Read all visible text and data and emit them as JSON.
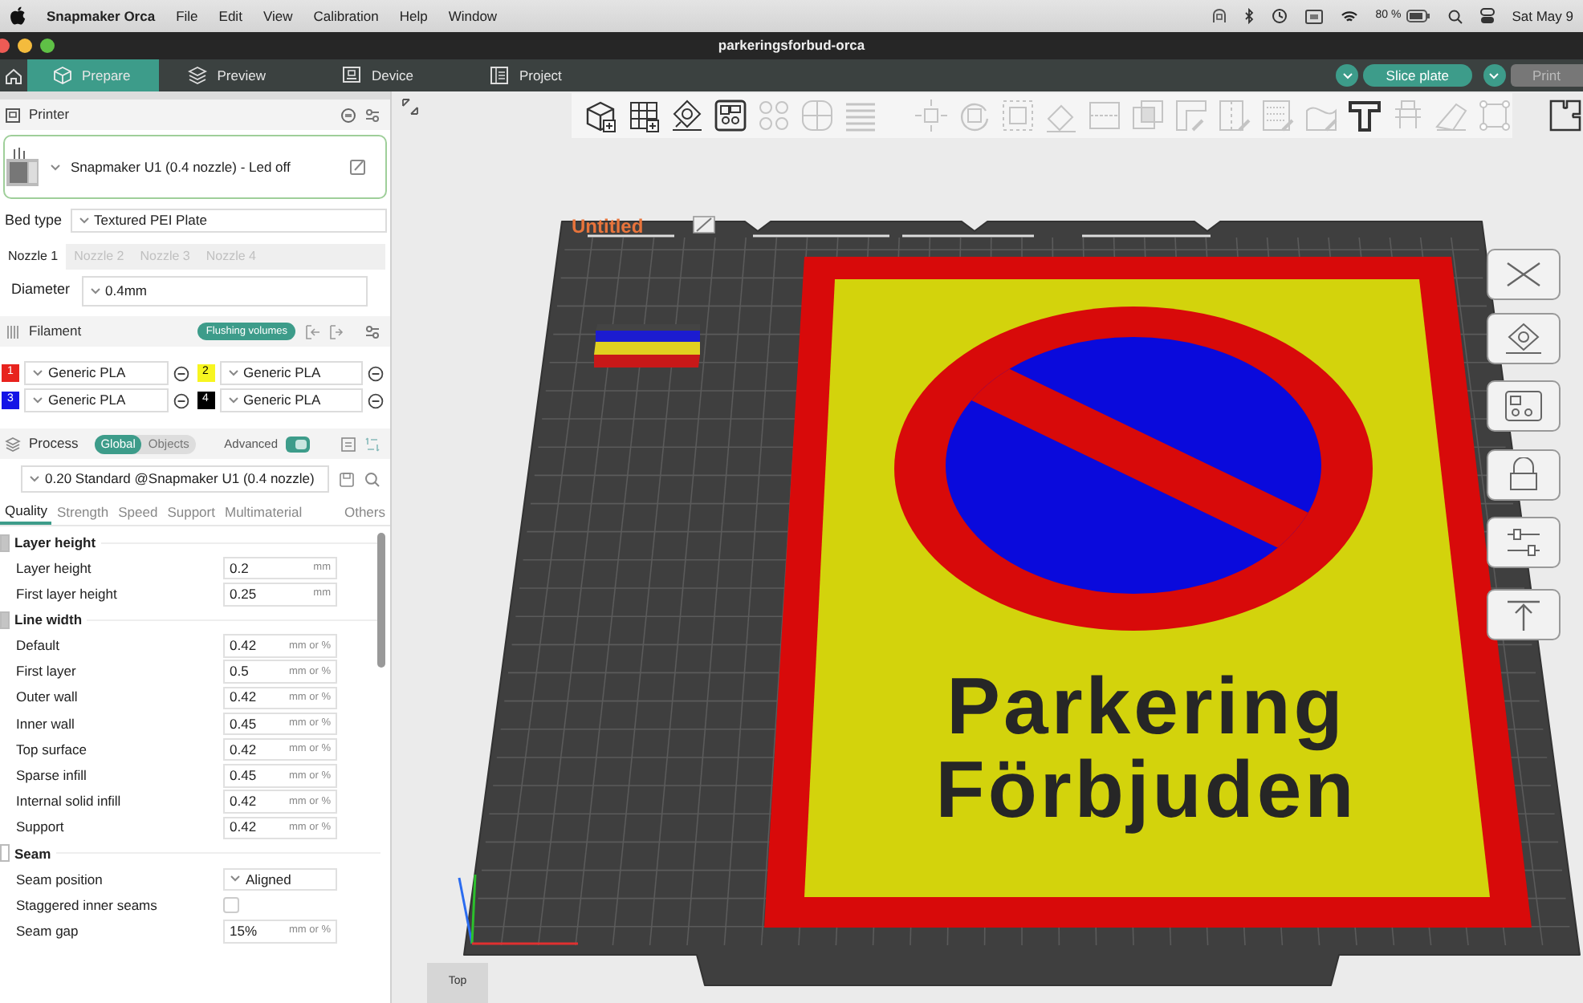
{
  "menubar": {
    "app": "Snapmaker Orca",
    "menus": [
      "File",
      "Edit",
      "View",
      "Calibration",
      "Help",
      "Window"
    ],
    "battery": "80 %",
    "clock": "Sat May 9"
  },
  "window": {
    "title": "parkeringsforbud-orca"
  },
  "tabs": [
    {
      "label": "Prepare",
      "selected": true
    },
    {
      "label": "Preview",
      "selected": false
    },
    {
      "label": "Device",
      "selected": false
    },
    {
      "label": "Project",
      "selected": false
    }
  ],
  "actions": [
    {
      "label": "Slice plate",
      "disabled": false
    },
    {
      "label": "Print",
      "disabled": true
    }
  ],
  "printer": {
    "title": "Printer",
    "name": "Snapmaker U1 (0.4 nozzle) - Led off",
    "bed_type": {
      "label": "Bed type",
      "value": "Textured PEI Plate"
    },
    "nozzles": [
      {
        "label": "Nozzle 1",
        "selected": true
      },
      {
        "label": "Nozzle 2",
        "selected": false
      },
      {
        "label": "Nozzle 3",
        "selected": false
      },
      {
        "label": "Nozzle 4",
        "selected": false
      }
    ],
    "diameter": {
      "label": "Diameter",
      "value": "0.4mm"
    }
  },
  "filament": {
    "title": "Filament",
    "flush_button": "Flushing volumes",
    "items": [
      {
        "number": "1",
        "color": "#e8231e",
        "name": "Generic PLA"
      },
      {
        "number": "2",
        "color": "#f7f520",
        "name": "Generic PLA"
      },
      {
        "number": "3",
        "color": "#1414e6",
        "name": "Generic PLA"
      },
      {
        "number": "4",
        "color": "#000000",
        "name": "Generic PLA"
      }
    ]
  },
  "process": {
    "title": "Process",
    "scopes": [
      {
        "label": "Global",
        "selected": true
      },
      {
        "label": "Objects",
        "selected": false
      }
    ],
    "advanced": {
      "label": "Advanced",
      "on": true
    },
    "preset": "0.20 Standard @Snapmaker U1 (0.4 nozzle)",
    "tabs": [
      {
        "label": "Quality",
        "selected": true
      },
      {
        "label": "Strength",
        "selected": false
      },
      {
        "label": "Speed",
        "selected": false
      },
      {
        "label": "Support",
        "selected": false
      },
      {
        "label": "Multimaterial",
        "selected": false
      },
      {
        "label": "Others",
        "selected": false
      }
    ],
    "groups": [
      {
        "title": "Layer height",
        "rows": [
          {
            "kind": "number",
            "label": "Layer height",
            "value": "0.2",
            "unit": "mm"
          },
          {
            "kind": "number",
            "label": "First layer height",
            "value": "0.25",
            "unit": "mm"
          }
        ]
      },
      {
        "title": "Line width",
        "rows": [
          {
            "kind": "number",
            "label": "Default",
            "value": "0.42",
            "unit": "mm or %"
          },
          {
            "kind": "number",
            "label": "First layer",
            "value": "0.5",
            "unit": "mm or %"
          },
          {
            "kind": "number",
            "label": "Outer wall",
            "value": "0.42",
            "unit": "mm or %"
          },
          {
            "kind": "number",
            "label": "Inner wall",
            "value": "0.45",
            "unit": "mm or %"
          },
          {
            "kind": "number",
            "label": "Top surface",
            "value": "0.42",
            "unit": "mm or %"
          },
          {
            "kind": "number",
            "label": "Sparse infill",
            "value": "0.45",
            "unit": "mm or %"
          },
          {
            "kind": "number",
            "label": "Internal solid infill",
            "value": "0.42",
            "unit": "mm or %"
          },
          {
            "kind": "number",
            "label": "Support",
            "value": "0.42",
            "unit": "mm or %"
          }
        ]
      },
      {
        "title": "Seam",
        "rows": [
          {
            "kind": "dropdown",
            "label": "Seam position",
            "value": "Aligned"
          },
          {
            "kind": "checkbox",
            "label": "Staggered inner seams",
            "checked": false
          },
          {
            "kind": "number",
            "label": "Seam gap",
            "value": "15%",
            "unit": "mm or %"
          }
        ]
      }
    ]
  },
  "toolbar": {
    "groups": [
      [
        {
          "disabled": false
        },
        {
          "disabled": false
        },
        {
          "disabled": false
        },
        {
          "disabled": false
        },
        {
          "disabled": true
        },
        {
          "disabled": true
        },
        {
          "disabled": true
        }
      ],
      [
        {
          "disabled": true
        },
        {
          "disabled": true
        },
        {
          "disabled": true
        },
        {
          "disabled": true
        },
        {
          "disabled": true
        },
        {
          "disabled": true
        },
        {
          "disabled": true
        },
        {
          "disabled": true
        },
        {
          "disabled": true
        },
        {
          "disabled": true
        },
        {
          "disabled": false
        },
        {
          "disabled": true
        },
        {
          "disabled": true
        },
        {
          "disabled": true
        }
      ],
      [
        {
          "disabled": false
        }
      ]
    ]
  },
  "plate": {
    "name": "Untitled",
    "sign_text": [
      "Parkering",
      "Förbjuden"
    ]
  },
  "view_button": "Top"
}
